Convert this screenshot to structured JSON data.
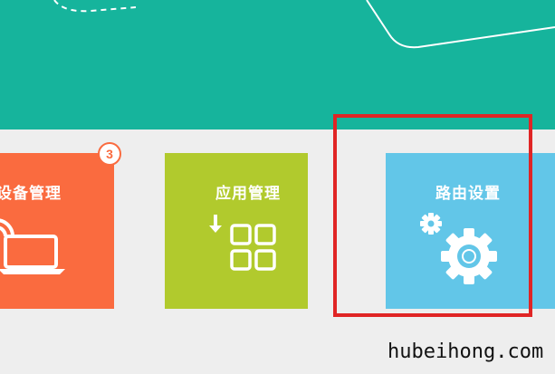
{
  "tiles": {
    "device_management": {
      "label": "设备管理",
      "badge": "3",
      "icon": "laptop-wifi-icon",
      "color": "#fa6b3f"
    },
    "app_management": {
      "label": "应用管理",
      "icon": "app-grid-download-icon",
      "color": "#b1ca2d"
    },
    "router_settings": {
      "label": "路由设置",
      "icon": "gear-icon",
      "color": "#62c6e8"
    }
  },
  "banner": {
    "color": "#16b49c"
  },
  "highlight": {
    "color": "#e02525"
  },
  "watermark": "hubeihong.com"
}
